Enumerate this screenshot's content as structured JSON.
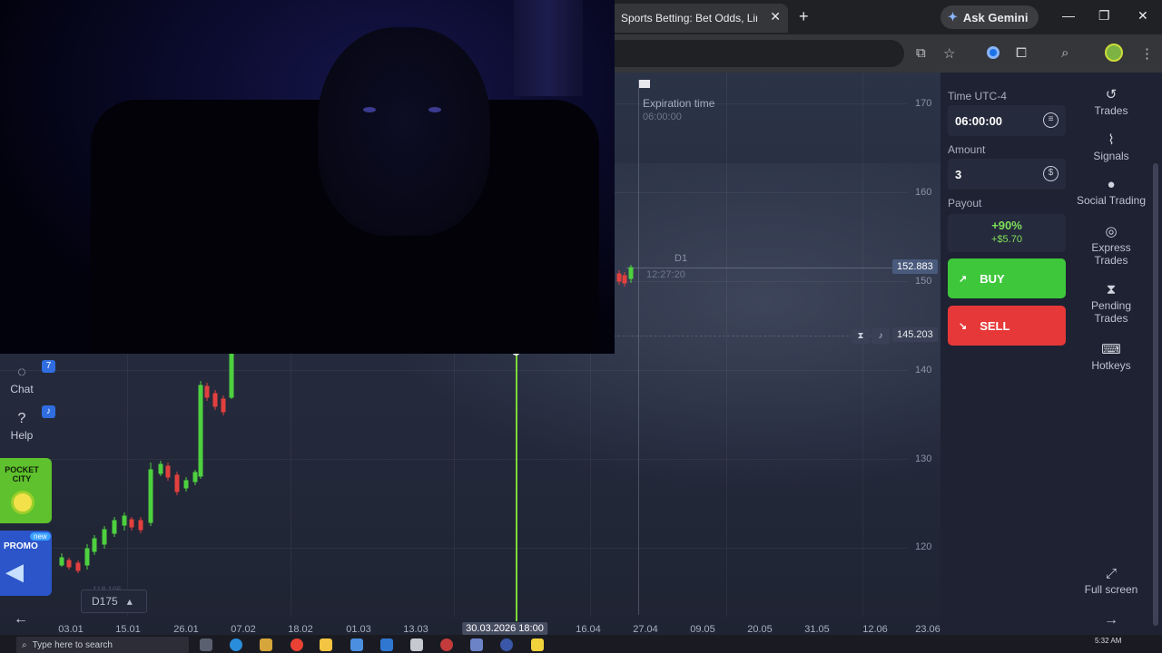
{
  "browser": {
    "tab_title": "Sports Betting: Bet Odds, Lines",
    "tab_close": "✕",
    "new_tab": "+",
    "gemini_label": "Ask Gemini",
    "window_controls": {
      "minimize": "—",
      "maximize": "❐",
      "close": "✕"
    }
  },
  "chart": {
    "expiration_title": "Expiration time",
    "expiration_value": "06:00:00",
    "timeframe": "D1",
    "timer": "12:27:20",
    "current_price": "152.883",
    "alert_price": "145.203",
    "period_selector": "D175",
    "period_arrow": "▴",
    "faded_value": "118.195",
    "y_ticks": [
      "170",
      "160",
      "150",
      "140",
      "130",
      "120"
    ],
    "x_ticks": [
      "03.01",
      "15.01",
      "26.01",
      "07.02",
      "18.02",
      "01.03",
      "13.03",
      "30.03.2026 18:00",
      "16.04",
      "27.04",
      "09.05",
      "20.05",
      "31.05",
      "12.06",
      "23.06"
    ]
  },
  "left_nav": {
    "chat_label": "Chat",
    "chat_badge": "7",
    "help_label": "Help",
    "promo_city": "POCKET CITY",
    "promo_label": "PROMO",
    "promo_new": "new"
  },
  "trade_panel": {
    "time_label": "Time UTC-4",
    "time_value": "06:00:00",
    "amount_label": "Amount",
    "amount_value": "3",
    "payout_label": "Payout",
    "payout_percent": "+90%",
    "payout_amount": "+$5.70",
    "buy_label": "BUY",
    "sell_label": "SELL"
  },
  "right_nav": {
    "items": [
      "Trades",
      "Signals",
      "Social Trading",
      "Express Trades",
      "Pending Trades",
      "Hotkeys"
    ],
    "fullscreen": "Full screen",
    "arrow": "→"
  },
  "taskbar": {
    "search_placeholder": "Type here to search",
    "time": "5:32 AM"
  },
  "colors": {
    "buy": "#3fc73c",
    "sell": "#e63838",
    "bull_candle": "#4ed13f",
    "bear_candle": "#e2403e"
  }
}
